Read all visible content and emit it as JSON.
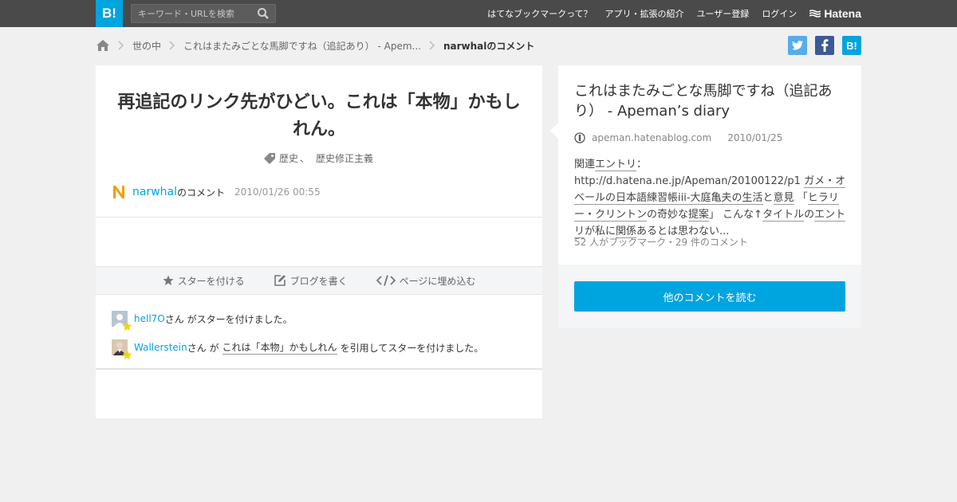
{
  "header": {
    "logo": "B!",
    "search_placeholder": "キーワード・URLを検索",
    "nav": [
      "はてなブックマークって？",
      "アプリ・拡張の紹介",
      "ユーザー登録",
      "ログイン"
    ],
    "brand": "Hatena"
  },
  "breadcrumb": {
    "items": [
      "世の中",
      "これはまたみごとな馬脚ですね（追記あり） - Apem..."
    ],
    "current": "narwhalのコメント"
  },
  "share": {
    "hatena_label": "B!"
  },
  "comment": {
    "title": "再追記のリンク先がひどい。これは「本物」かもしれん。",
    "tags": [
      "歴史",
      "歴史修正主義"
    ],
    "tag_separator": "、",
    "author": "narwhal",
    "author_suffix": "のコメント",
    "date": "2010/01/26 00:55"
  },
  "actions": {
    "star": "スターを付ける",
    "blog": "ブログを書く",
    "embed": "ページに埋め込む"
  },
  "stars": [
    {
      "user": "hell7O",
      "text": "さん がスターを付けました。"
    },
    {
      "user": "Wallerstein",
      "pre": "さん が",
      "quote": "これは「本物」かもしれん",
      "post": "を引用してスターを付けました。"
    }
  ],
  "entry": {
    "title": "これはまたみごとな馬脚ですね（追記あり） - Apeman’s diary",
    "domain": "apeman.hatenablog.com",
    "date": "2010/01/25",
    "desc": {
      "p1": "関連",
      "k1": "エントリ",
      "p2": "：http://d.hatena.ne.jp/Apeman/20100122/p1 ",
      "k2": "ガメ・オベールの日本語練習帳iii-大庭亀夫の",
      "k3": "生活",
      "p3": "と",
      "k4": "意見",
      "p4": " 「",
      "k5": "ヒラリー・クリントン",
      "p5": "の奇妙な",
      "k6": "提案",
      "p6": "」 こんな↑",
      "k7": "タイトル",
      "p7": "の",
      "k8": "エントリ",
      "p8": "が私に",
      "k9": "関係",
      "p9": "あるとは思わない..."
    },
    "count": "52 人がブックマーク・29 件のコメント",
    "read_button": "他のコメントを読む"
  }
}
